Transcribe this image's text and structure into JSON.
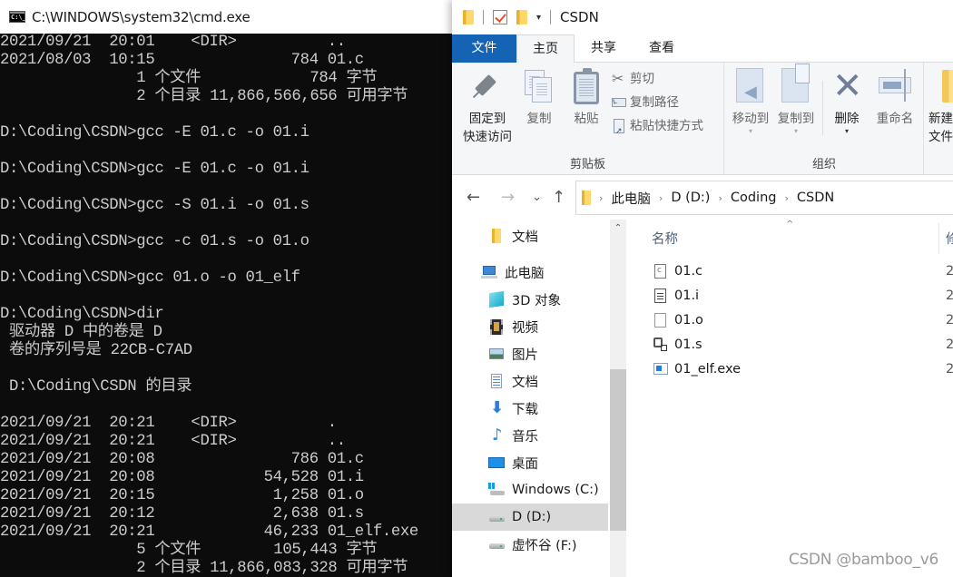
{
  "cmd": {
    "title": "C:\\WINDOWS\\system32\\cmd.exe",
    "icon": "cmd-prompt-icon",
    "lines": [
      "2021/09/21  20:01    <DIR>          ..",
      "2021/08/03  10:15               784 01.c",
      "               1 个文件            784 字节",
      "               2 个目录 11,866,566,656 可用字节",
      "",
      "D:\\Coding\\CSDN>gcc -E 01.c -o 01.i",
      "",
      "D:\\Coding\\CSDN>gcc -E 01.c -o 01.i",
      "",
      "D:\\Coding\\CSDN>gcc -S 01.i -o 01.s",
      "",
      "D:\\Coding\\CSDN>gcc -c 01.s -o 01.o",
      "",
      "D:\\Coding\\CSDN>gcc 01.o -o 01_elf",
      "",
      "D:\\Coding\\CSDN>dir",
      " 驱动器 D 中的卷是 D",
      " 卷的序列号是 22CB-C7AD",
      "",
      " D:\\Coding\\CSDN 的目录",
      "",
      "2021/09/21  20:21    <DIR>          .",
      "2021/09/21  20:21    <DIR>          ..",
      "2021/09/21  20:08               786 01.c",
      "2021/09/21  20:08            54,528 01.i",
      "2021/09/21  20:15             1,258 01.o",
      "2021/09/21  20:12             2,638 01.s",
      "2021/09/21  20:21            46,233 01_elf.exe",
      "               5 个文件        105,443 字节",
      "               2 个目录 11,866,083,328 可用字节"
    ]
  },
  "explorer": {
    "title": "CSDN",
    "quick_access_dropdown": "▾",
    "tabs": [
      {
        "label": "文件"
      },
      {
        "label": "主页"
      },
      {
        "label": "共享"
      },
      {
        "label": "查看"
      }
    ],
    "ribbon": {
      "clipboard": {
        "group_label": "剪贴板",
        "pin_label_1": "固定到",
        "pin_label_2": "快速访问",
        "copy_label": "复制",
        "paste_label": "粘贴",
        "cut_label": "剪切",
        "copy_path_label": "复制路径",
        "paste_shortcut_label": "粘贴快捷方式",
        "scissors_glyph": "✂",
        "path_glyph": "\\\\..."
      },
      "organize": {
        "group_label": "组织",
        "move_to_label": "移动到",
        "copy_to_label": "复制到",
        "delete_label": "删除",
        "rename_label": "重命名",
        "delete_glyph": "✕",
        "dropdown_glyph": "▾"
      },
      "new": {
        "new_folder_label_1": "新建",
        "new_folder_label_2": "文件夹"
      }
    },
    "nav_buttons": {
      "back": "←",
      "forward": "→",
      "recent": "⌄",
      "up": "↑"
    },
    "breadcrumb": [
      "此电脑",
      "D (D:)",
      "Coding",
      "CSDN"
    ],
    "breadcrumb_sep": "›",
    "nav_pane": {
      "scroll_up_glyph": "⌃",
      "scroll_thumb_start": 0.42,
      "scroll_thumb_end": 0.87,
      "items": [
        {
          "label": "文档",
          "icon": "folder-icon"
        },
        {
          "label": "此电脑",
          "icon": "this-pc-icon"
        },
        {
          "label": "3D 对象",
          "icon": "3d-objects-icon"
        },
        {
          "label": "视频",
          "icon": "videos-icon"
        },
        {
          "label": "图片",
          "icon": "pictures-icon"
        },
        {
          "label": "文档",
          "icon": "documents-icon"
        },
        {
          "label": "下载",
          "icon": "downloads-icon"
        },
        {
          "label": "音乐",
          "icon": "music-icon"
        },
        {
          "label": "桌面",
          "icon": "desktop-icon"
        },
        {
          "label": "Windows (C:)",
          "icon": "windows-drive-icon"
        },
        {
          "label": "D (D:)",
          "icon": "drive-icon",
          "selected": true
        },
        {
          "label": "虚怀谷 (F:)",
          "icon": "drive-icon"
        }
      ]
    },
    "file_list": {
      "column_name": "名称",
      "column_date_stub": "修",
      "sort_glyph": "^",
      "files": [
        {
          "name": "01.c",
          "icon": "c-source-file-icon",
          "date_stub": "2"
        },
        {
          "name": "01.i",
          "icon": "text-file-icon",
          "date_stub": "2"
        },
        {
          "name": "01.o",
          "icon": "blank-file-icon",
          "date_stub": "2"
        },
        {
          "name": "01.s",
          "icon": "assembly-file-icon",
          "date_stub": "2"
        },
        {
          "name": "01_elf.exe",
          "icon": "exe-file-icon",
          "date_stub": "2"
        }
      ]
    }
  },
  "watermark": "CSDN @bamboo_v6"
}
